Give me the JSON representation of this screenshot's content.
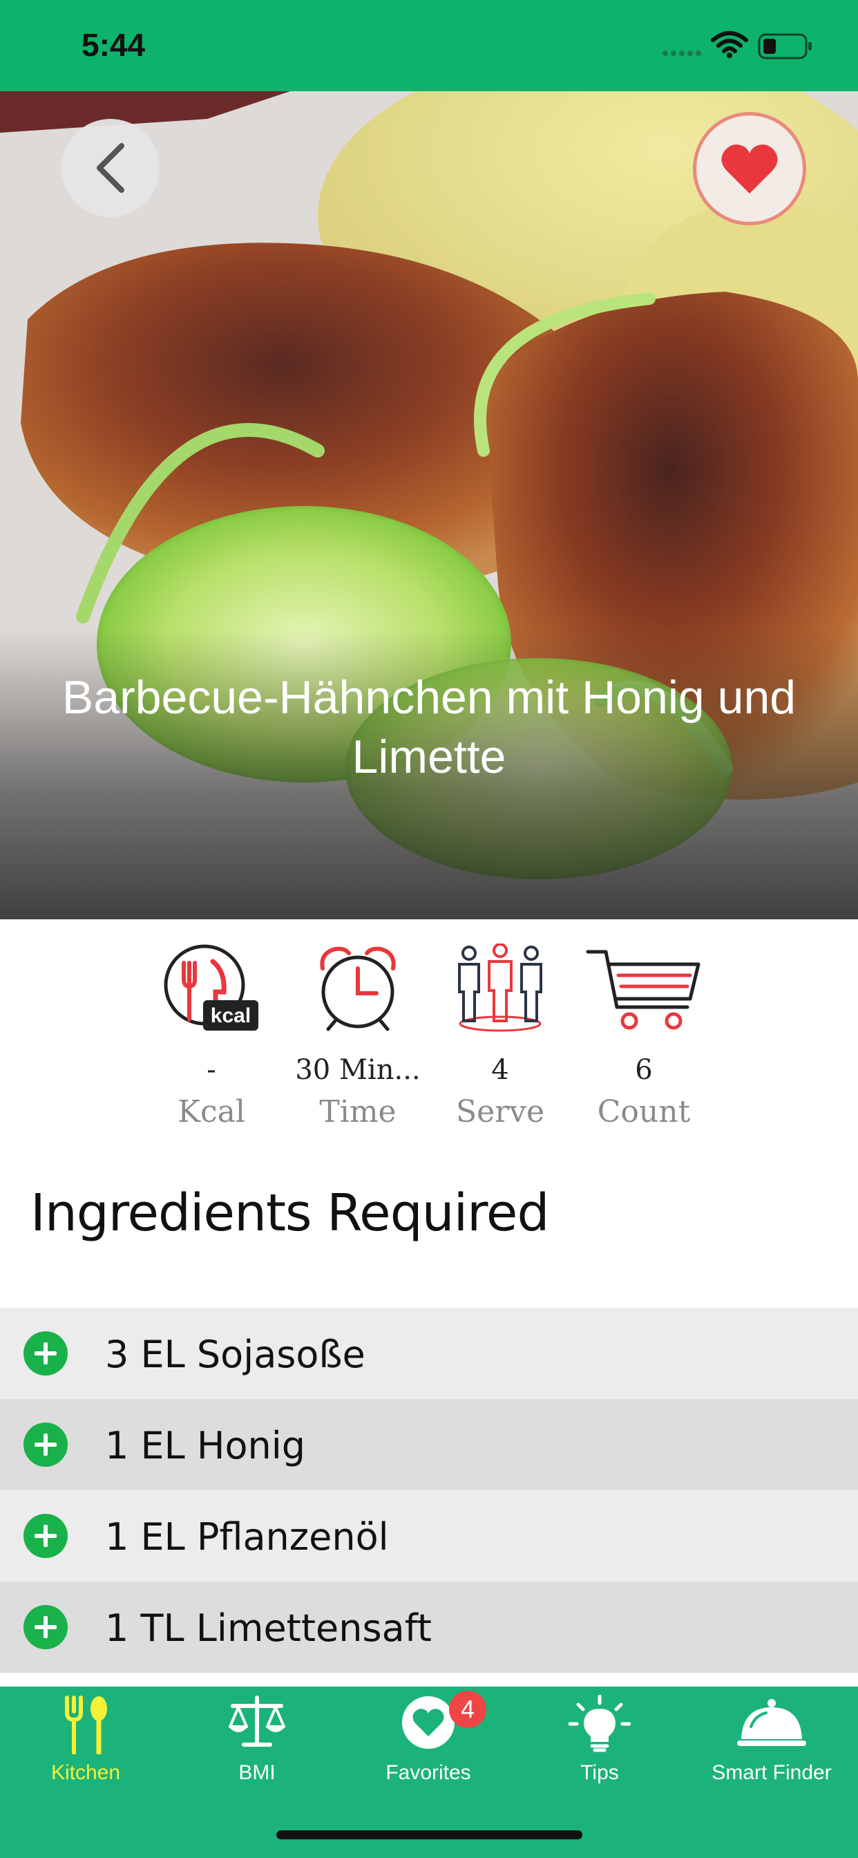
{
  "status_bar": {
    "time": "5:44"
  },
  "recipe": {
    "title": "Barbecue-Hähnchen mit Honig und Limette",
    "stats": [
      {
        "icon": "kcal-icon",
        "value": "-",
        "label": "Kcal"
      },
      {
        "icon": "alarm-clock-icon",
        "value": "30 Min...",
        "label": "Time"
      },
      {
        "icon": "people-icon",
        "value": "4",
        "label": "Serve"
      },
      {
        "icon": "shopping-cart-icon",
        "value": "6",
        "label": "Count"
      }
    ],
    "kcal_icon_text": "kcal"
  },
  "ingredients_section": {
    "title": "Ingredients Required",
    "items": [
      "3 EL Sojasoße",
      "1 EL Honig",
      "1 EL Pflanzenöl",
      "1 TL Limettensaft"
    ]
  },
  "tab_bar": {
    "tabs": [
      {
        "label": "Kitchen",
        "icon": "fork-spoon-icon",
        "active": true
      },
      {
        "label": "BMI",
        "icon": "scale-icon",
        "active": false
      },
      {
        "label": "Favorites",
        "icon": "heart-icon",
        "active": false
      },
      {
        "label": "Tips",
        "icon": "lightbulb-icon",
        "active": false
      },
      {
        "label": "Smart Finder",
        "icon": "cloche-icon",
        "active": false
      }
    ],
    "favorites_badge": "4"
  },
  "colors": {
    "brand_green": "#0db26b",
    "tab_bar_green": "#1bb37a",
    "active_tab": "#f6f036",
    "accent_red": "#e8373d",
    "plus_green": "#19b24a"
  }
}
